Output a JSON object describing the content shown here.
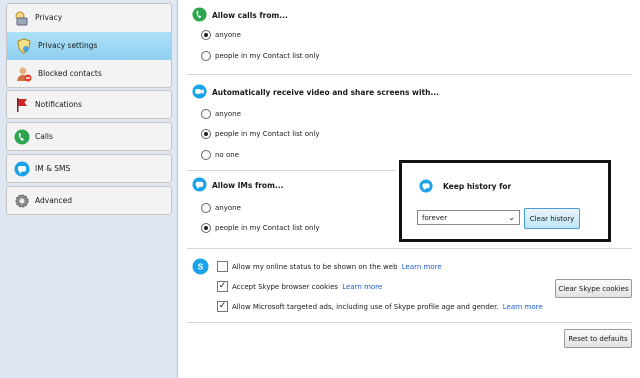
{
  "sidebar": {
    "privacy": {
      "label": "Privacy",
      "icon": "padlock-icon"
    },
    "privacy_settings": {
      "label": "Privacy settings",
      "icon": "shield-icon"
    },
    "blocked_contacts": {
      "label": "Blocked contacts",
      "icon": "blocked-user-icon"
    },
    "notifications": {
      "label": "Notifications",
      "icon": "flag-icon"
    },
    "calls": {
      "label": "Calls",
      "icon": "phone-icon"
    },
    "im_sms": {
      "label": "IM & SMS",
      "icon": "skype-chat-icon"
    },
    "advanced": {
      "label": "Advanced",
      "icon": "gear-icon"
    }
  },
  "calls_section": {
    "title": "Allow calls from...",
    "options": [
      {
        "label": "anyone",
        "selected": true
      },
      {
        "label": "people in my Contact list only",
        "selected": false
      }
    ]
  },
  "video_section": {
    "title": "Automatically receive video and share screens with...",
    "options": [
      {
        "label": "anyone",
        "selected": false
      },
      {
        "label": "people in my Contact list only",
        "selected": true
      },
      {
        "label": "no one",
        "selected": false
      }
    ]
  },
  "im_section": {
    "title": "Allow IMs from...",
    "options": [
      {
        "label": "anyone",
        "selected": false
      },
      {
        "label": "people in my Contact list only",
        "selected": true
      }
    ]
  },
  "history": {
    "title": "Keep history for",
    "selected": "forever",
    "clear_label": "Clear history"
  },
  "extras": {
    "online_status": {
      "label": "Allow my online status to be shown on the web",
      "link": "Learn more",
      "checked": false
    },
    "browser_cookies": {
      "label": "Accept Skype browser cookies",
      "link": "Learn more",
      "checked": true
    },
    "targeted_ads": {
      "label": "Allow Microsoft targeted ads, including use of Skype profile age and gender.",
      "link": "Learn more",
      "checked": true
    },
    "clear_cookies_label": "Clear Skype cookies",
    "reset_label": "Reset to defaults"
  },
  "colors": {
    "selected_bg": "#9ed8f4",
    "sidebar_bg": "#dfe8f2",
    "link": "#1a5cc8",
    "skype_blue": "#1aa3e8",
    "call_green": "#2da44e"
  }
}
